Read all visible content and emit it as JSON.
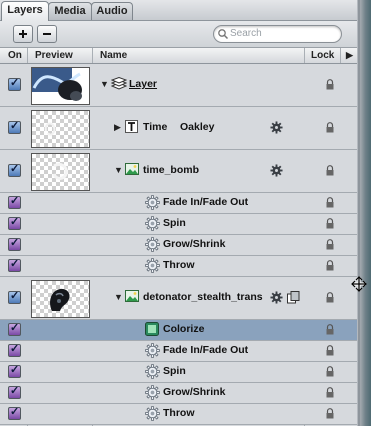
{
  "tabs": [
    {
      "label": "Layers",
      "active": true
    },
    {
      "label": "Media",
      "active": false
    },
    {
      "label": "Audio",
      "active": false
    }
  ],
  "toolbar": {
    "add_icon": "plus-icon",
    "remove_icon": "minus-icon",
    "search_placeholder": "Search"
  },
  "columns": {
    "on": "On",
    "preview": "Preview",
    "name": "Name",
    "lock": "Lock"
  },
  "rows": [
    {
      "name": "Layer",
      "kind": "group",
      "on": true,
      "check_color": "blue",
      "underlined": true
    },
    {
      "name": "Time",
      "extra": "Oakley",
      "kind": "text",
      "on": true,
      "check_color": "blue"
    },
    {
      "name": "time_bomb",
      "kind": "image",
      "on": true,
      "check_color": "blue"
    },
    {
      "name": "Fade In/Fade Out",
      "kind": "behavior",
      "on": true,
      "check_color": "purple"
    },
    {
      "name": "Spin",
      "kind": "behavior",
      "on": true,
      "check_color": "purple"
    },
    {
      "name": "Grow/Shrink",
      "kind": "behavior",
      "on": true,
      "check_color": "purple"
    },
    {
      "name": "Throw",
      "kind": "behavior",
      "on": true,
      "check_color": "purple"
    },
    {
      "name": "detonator_stealth_trans",
      "kind": "image",
      "on": true,
      "check_color": "blue"
    },
    {
      "name": "Colorize",
      "kind": "filter",
      "on": true,
      "check_color": "purple",
      "selected": true
    },
    {
      "name": "Fade In/Fade Out",
      "kind": "behavior",
      "on": true,
      "check_color": "purple"
    },
    {
      "name": "Spin",
      "kind": "behavior",
      "on": true,
      "check_color": "purple"
    },
    {
      "name": "Grow/Shrink",
      "kind": "behavior",
      "on": true,
      "check_color": "purple"
    },
    {
      "name": "Throw",
      "kind": "behavior",
      "on": true,
      "check_color": "purple"
    }
  ],
  "colors": {
    "selection": "#8aa2bd",
    "layer_check": "#4d79b7",
    "behavior_check": "#7a4aa6"
  }
}
